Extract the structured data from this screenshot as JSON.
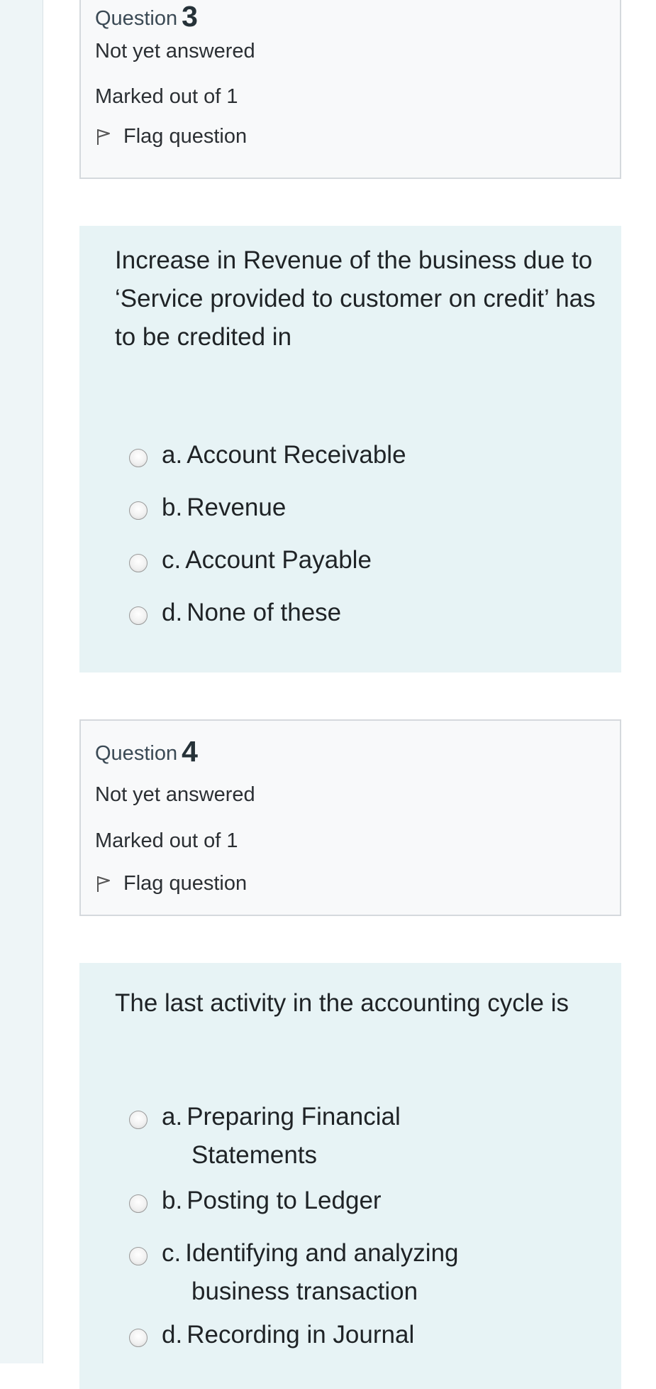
{
  "q3": {
    "label": "Question",
    "number": "3",
    "state": "Not yet answered",
    "grade": "Marked out of 1",
    "flag": "Flag question",
    "text": "Increase in Revenue of the business due to ‘Service provided to customer on credit’ has to be credited in",
    "answers": [
      {
        "letter": "a.",
        "text": "Account Receivable"
      },
      {
        "letter": "b.",
        "text": "Revenue"
      },
      {
        "letter": "c.",
        "text": "Account Payable"
      },
      {
        "letter": "d.",
        "text": "None of these"
      }
    ]
  },
  "q4": {
    "label": "Question",
    "number": "4",
    "state": "Not yet answered",
    "grade": "Marked out of 1",
    "flag": "Flag question",
    "text": "The last activity in the accounting cycle is",
    "answers": [
      {
        "letter": "a.",
        "text_line1": "Preparing Financial",
        "text_line2": "Statements"
      },
      {
        "letter": "b.",
        "text": "Posting to Ledger"
      },
      {
        "letter": "c.",
        "text_line1": "Identifying and analyzing",
        "text_line2": "business transaction"
      },
      {
        "letter": "d.",
        "text": "Recording in Journal"
      }
    ]
  },
  "icons": {
    "flag": "flag-icon",
    "radio": "radio-unchecked-icon"
  }
}
